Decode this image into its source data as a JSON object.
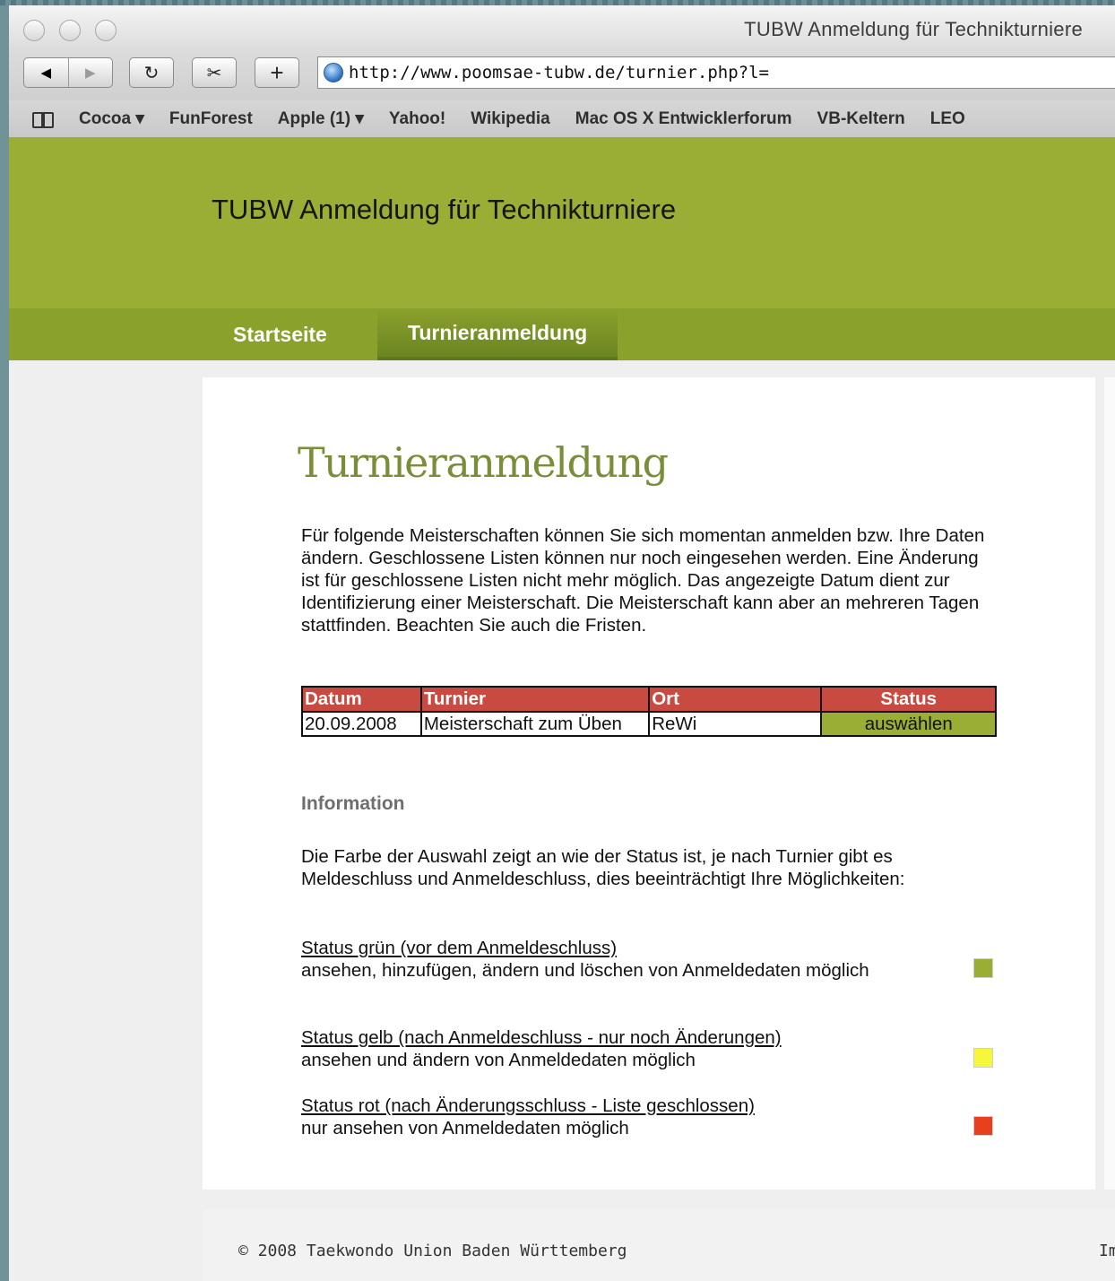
{
  "window": {
    "title": "TUBW Anmeldung für Technikturniere"
  },
  "toolbar": {
    "back_icon": "◀",
    "forward_icon": "▶",
    "reload_icon": "↻",
    "snippet_icon": "✂",
    "add_icon": "+",
    "url": "http://www.poomsae-tubw.de/turnier.php?l="
  },
  "bookmarks": {
    "items": [
      "Cocoa ▾",
      "FunForest",
      "Apple (1) ▾",
      "Yahoo!",
      "Wikipedia",
      "Mac OS X Entwicklerforum",
      "VB-Keltern",
      "LEO"
    ]
  },
  "site": {
    "title": "TUBW Anmeldung für Technikturniere",
    "nav": [
      "Startseite",
      "Turnieranmeldung"
    ]
  },
  "main": {
    "heading": "Turnieranmeldung",
    "intro": "Für folgende Meisterschaften können Sie sich momentan anmelden bzw. Ihre Daten ändern. Geschlossene Listen können nur noch eingesehen werden. Eine Änderung ist für geschlossene Listen nicht mehr möglich. Das angezeigte Datum dient zur Identifizierung einer Meisterschaft. Die Meisterschaft kann aber an mehreren Tagen stattfinden. Beachten Sie auch die Fristen.",
    "table": {
      "headers": [
        "Datum",
        "Turnier",
        "Ort",
        "Status"
      ],
      "rows": [
        {
          "datum": "20.09.2008",
          "turnier": "Meisterschaft zum Üben",
          "ort": "ReWi",
          "status": "auswählen"
        }
      ]
    },
    "info_title": "Information",
    "info_text": "Die Farbe der Auswahl zeigt an wie der Status ist, je nach Turnier gibt es Meldeschluss und Anmeldeschluss, dies beeinträchtigt Ihre Möglichkeiten:",
    "legend": [
      {
        "title": "Status grün (vor dem Anmeldeschluss)",
        "desc": "ansehen, hinzufügen, ändern und löschen von Anmeldedaten möglich",
        "color": "#9aae36"
      },
      {
        "title": "Status gelb (nach Anmeldeschluss - nur noch Änderungen)",
        "desc": "ansehen und ändern von Anmeldedaten möglich",
        "color": "#f7f73a"
      },
      {
        "title": "Status rot (nach Änderungsschluss - Liste geschlossen)",
        "desc": "nur ansehen von Anmeldedaten möglich",
        "color": "#e8401d"
      }
    ]
  },
  "footer": {
    "copyright": "© 2008 Taekwondo Union Baden Württemberg",
    "right_text": "Im"
  },
  "colors": {
    "header_green": "#9aae36",
    "nav_green": "#8aa12c",
    "table_header_red": "#c94a40",
    "heading_olive": "#7a8e3a"
  }
}
